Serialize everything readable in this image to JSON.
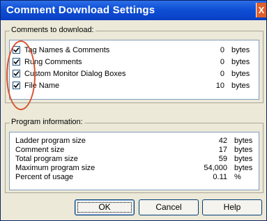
{
  "window": {
    "title": "Comment Download Settings",
    "close_glyph": "X"
  },
  "comments": {
    "group_title": "Comments to download:",
    "items": [
      {
        "label": "Tag Names & Comments",
        "value": "0",
        "unit": "bytes",
        "checked": true
      },
      {
        "label": "Rung Comments",
        "value": "0",
        "unit": "bytes",
        "checked": true
      },
      {
        "label": "Custom Monitor Dialog Boxes",
        "value": "0",
        "unit": "bytes",
        "checked": true
      },
      {
        "label": "File Name",
        "value": "10",
        "unit": "bytes",
        "checked": true
      }
    ]
  },
  "program": {
    "group_title": "Program information:",
    "rows": [
      {
        "label": "Ladder program size",
        "value": "42",
        "unit": "bytes"
      },
      {
        "label": "Comment size",
        "value": "17",
        "unit": "bytes"
      },
      {
        "label": "Total program size",
        "value": "59",
        "unit": "bytes"
      },
      {
        "label": "Maximum program size",
        "value": "54,000",
        "unit": "bytes"
      },
      {
        "label": "Percent of usage",
        "value": "0.11",
        "unit": "%"
      }
    ]
  },
  "buttons": {
    "ok": "OK",
    "cancel": "Cancel",
    "help": "Help"
  },
  "colors": {
    "titlebar": "#0e4fd6",
    "annotation_circle": "#d9502e"
  }
}
